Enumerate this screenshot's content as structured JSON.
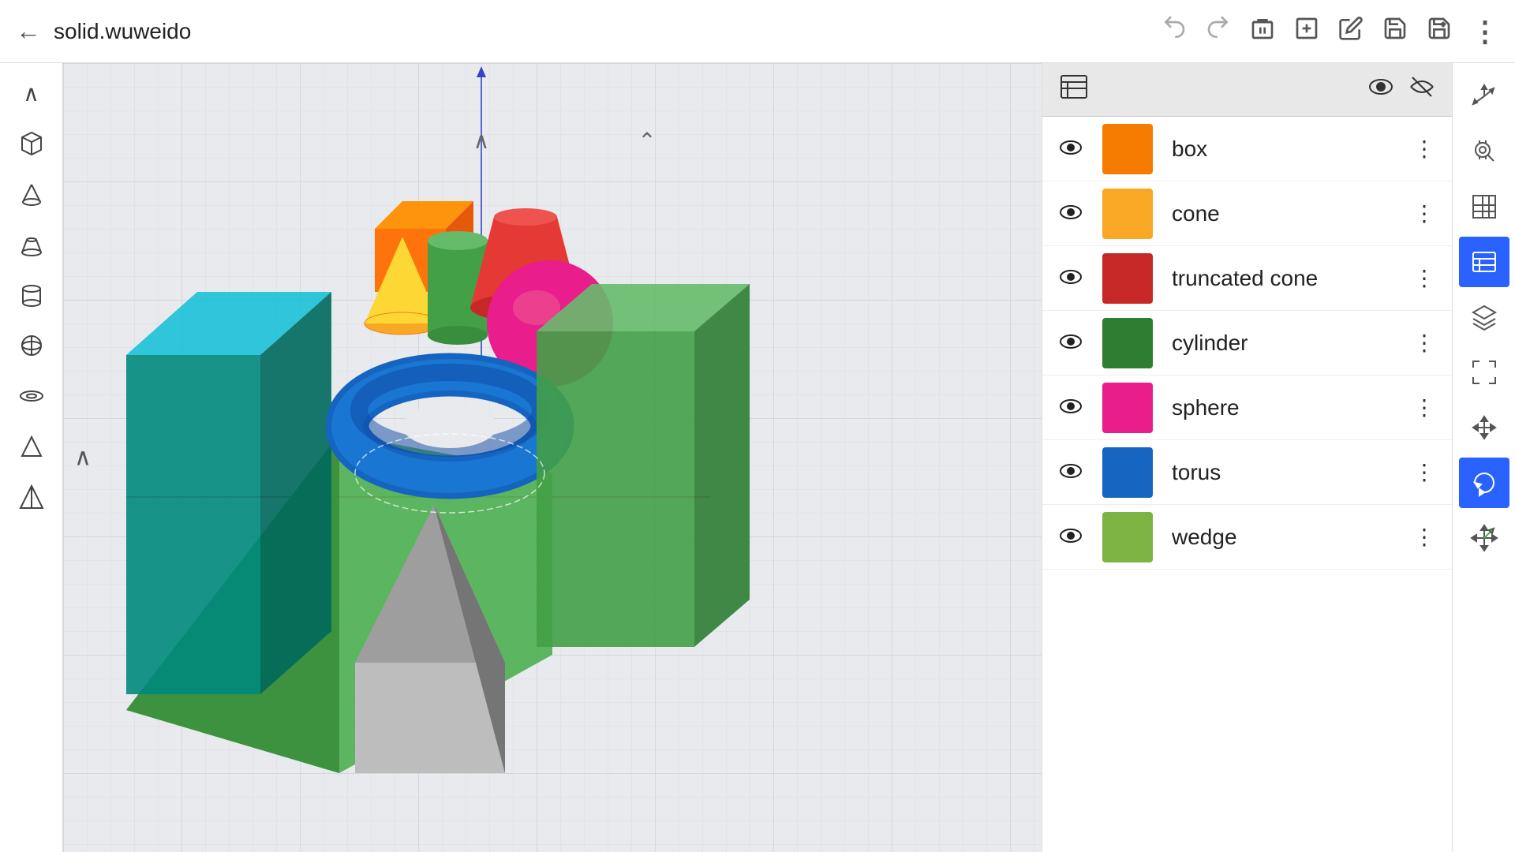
{
  "header": {
    "title": "solid.wuweido",
    "back_label": "←",
    "forward_label": "→",
    "delete_label": "🗑",
    "add_label": "⊞",
    "edit_label": "✏",
    "save_label": "💾",
    "save_as_label": "💾+",
    "more_label": "⋮"
  },
  "left_toolbar": {
    "tools": [
      {
        "name": "collapse-up",
        "icon": "∧",
        "label": "Collapse"
      },
      {
        "name": "box-tool",
        "icon": "cube",
        "label": "Box"
      },
      {
        "name": "cone-tool",
        "icon": "cone",
        "label": "Cone"
      },
      {
        "name": "truncated-cone-tool",
        "icon": "trcone",
        "label": "Truncated Cone"
      },
      {
        "name": "cylinder-tool",
        "icon": "cylinder",
        "label": "Cylinder"
      },
      {
        "name": "sphere-tool",
        "icon": "sphere",
        "label": "Sphere"
      },
      {
        "name": "torus-tool",
        "icon": "torus",
        "label": "Torus"
      },
      {
        "name": "wedge-tool",
        "icon": "wedge",
        "label": "Wedge"
      },
      {
        "name": "pyramid-tool",
        "icon": "pyramid",
        "label": "Pyramid"
      }
    ]
  },
  "right_toolbar": {
    "tools": [
      {
        "name": "axis-icon",
        "icon": "axis",
        "label": "Axis"
      },
      {
        "name": "search-view-icon",
        "icon": "searchview",
        "label": "Search View"
      },
      {
        "name": "grid-icon",
        "icon": "grid",
        "label": "Grid"
      },
      {
        "name": "layers-icon",
        "icon": "layers",
        "label": "Layers",
        "active": true
      },
      {
        "name": "layers2-icon",
        "icon": "layers2",
        "label": "Layers 2"
      },
      {
        "name": "fit-icon",
        "icon": "fit",
        "label": "Fit"
      },
      {
        "name": "move-icon",
        "icon": "move",
        "label": "Move"
      },
      {
        "name": "rotate-icon",
        "icon": "rotate",
        "label": "Rotate",
        "active": true
      },
      {
        "name": "transform-icon",
        "icon": "transform",
        "label": "Transform"
      }
    ]
  },
  "panel": {
    "header_icon": "≡",
    "eye_open_icon": "👁",
    "eye_closed_icon": "👁‍🗨"
  },
  "shapes": [
    {
      "name": "box",
      "color": "#f57c00",
      "visible": true
    },
    {
      "name": "cone",
      "color": "#f9a825",
      "visible": true
    },
    {
      "name": "truncated cone",
      "color": "#c62828",
      "visible": true
    },
    {
      "name": "cylinder",
      "color": "#2e7d32",
      "visible": true
    },
    {
      "name": "sphere",
      "color": "#e91e8c",
      "visible": true
    },
    {
      "name": "torus",
      "color": "#1565c0",
      "visible": true
    },
    {
      "name": "wedge",
      "color": "#7cb342",
      "visible": true
    }
  ],
  "canvas": {
    "bg_color": "#e8eaed",
    "grid_color": "#c8cdd4"
  }
}
